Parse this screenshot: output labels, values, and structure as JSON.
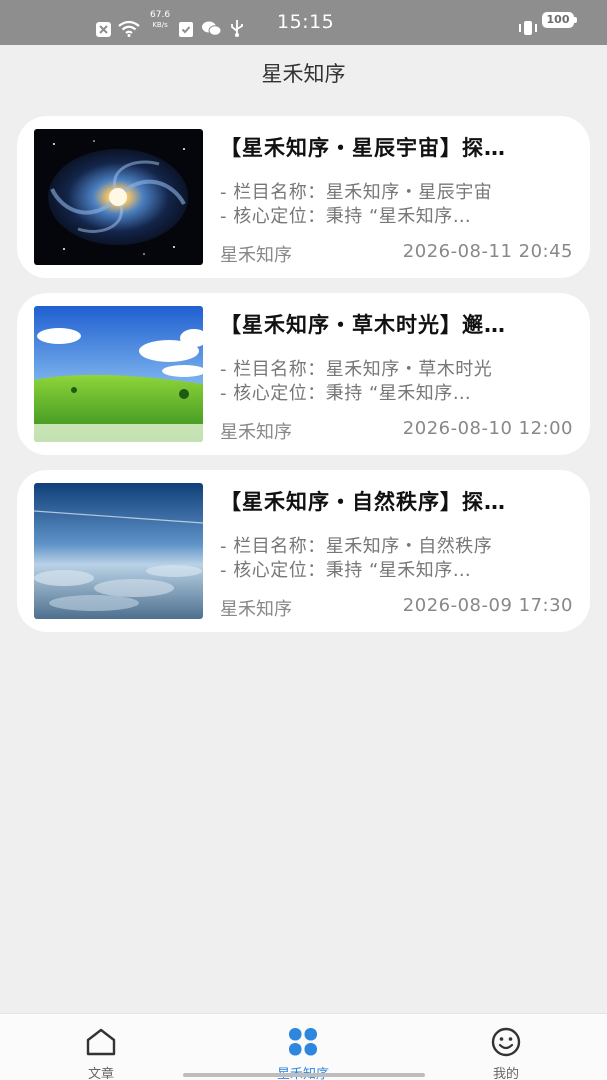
{
  "status_bar": {
    "time": "15:15",
    "net_speed_value": "67.6",
    "net_speed_unit": "KB/s",
    "battery": "100"
  },
  "header": {
    "title": "星禾知序"
  },
  "articles": [
    {
      "title": "【星禾知序・星辰宇宙】探…",
      "line1": "- 栏目名称：星禾知序・星辰宇宙",
      "line2": "- 核心定位：秉持 “星禾知序…",
      "author": "星禾知序",
      "date": "2026-08-11 20:45"
    },
    {
      "title": "【星禾知序・草木时光】邂…",
      "line1": "- 栏目名称：星禾知序・草木时光",
      "line2": "- 核心定位：秉持 “星禾知序…",
      "author": "星禾知序",
      "date": "2026-08-10 12:00"
    },
    {
      "title": "【星禾知序・自然秩序】探…",
      "line1": "- 栏目名称：星禾知序・自然秩序",
      "line2": "- 核心定位：秉持 “星禾知序…",
      "author": "星禾知序",
      "date": "2026-08-09 17:30"
    }
  ],
  "bottom_nav": {
    "items": [
      {
        "label": "文章",
        "icon": "home-icon",
        "active": false
      },
      {
        "label": "星禾知序",
        "icon": "grid-icon",
        "active": true
      },
      {
        "label": "我的",
        "icon": "smiley-icon",
        "active": false
      }
    ],
    "active_color": "#2e86de"
  }
}
